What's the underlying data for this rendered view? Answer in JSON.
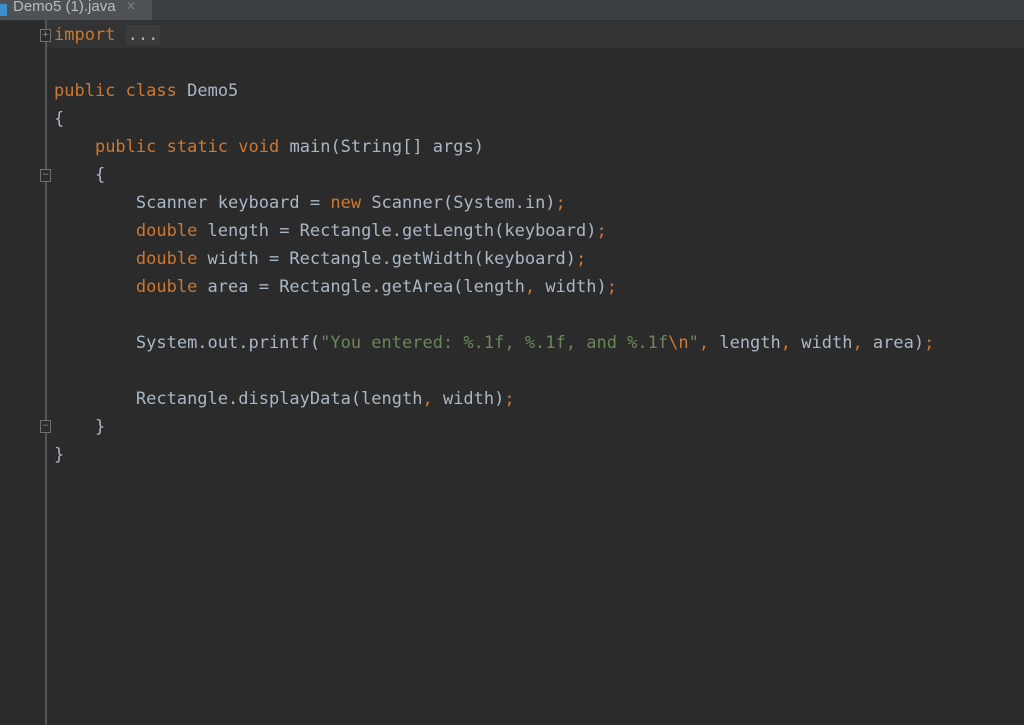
{
  "tab": {
    "title": "Demo5 (1).java",
    "close_glyph": "×"
  },
  "code": {
    "import_keyword": "import",
    "import_folded": "...",
    "lines": {
      "class_kw1": "public",
      "class_kw2": "class",
      "class_name": "Demo5",
      "open_brace": "{",
      "main_kw1": "public",
      "main_kw2": "static",
      "main_kw3": "void",
      "main_sig": "main(String[] args)",
      "main_open": "{",
      "scanner_pre": "Scanner keyboard = ",
      "scanner_new": "new",
      "scanner_post": " Scanner(System.in)",
      "length_type": "double",
      "length_expr": " length = Rectangle.getLength(keyboard)",
      "width_type": "double",
      "width_expr": " width = Rectangle.getWidth(keyboard)",
      "area_type": "double",
      "area_expr_a": " area = Rectangle.getArea(length",
      "area_expr_b": " width)",
      "printf_pre": "System.out.printf(",
      "printf_str": "\"You entered: %.1f, %.1f, and %.1f",
      "printf_esc": "\\n",
      "printf_quote": "\"",
      "printf_arg1": " length",
      "printf_arg2": " width",
      "printf_arg3": " area)",
      "display_a": "Rectangle.displayData(length",
      "display_b": " width)",
      "main_close": "}",
      "class_close": "}",
      "semicolon": ";",
      "comma": ","
    }
  },
  "colors": {
    "background": "#2b2b2b",
    "keyword": "#cc7832",
    "string": "#6a8759",
    "text": "#a9b7c6"
  }
}
